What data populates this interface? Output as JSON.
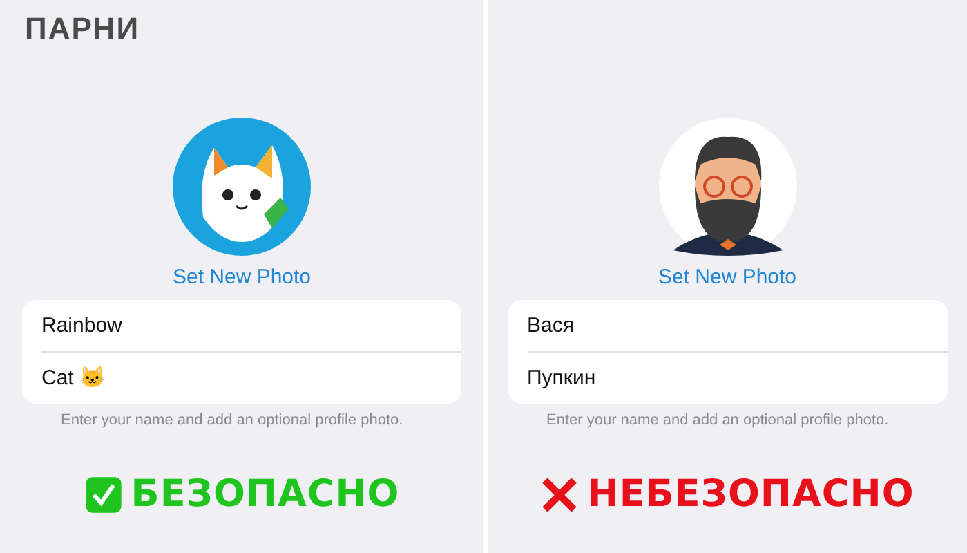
{
  "logo": {
    "text": "ПАРНИ"
  },
  "panels": [
    {
      "avatar": {
        "kind": "cat"
      },
      "set_photo": "Set New Photo",
      "fields": [
        {
          "value": "Rainbow"
        },
        {
          "value": "Cat 🐱"
        }
      ],
      "hint": "Enter your name and add an optional profile photo.",
      "verdict": {
        "kind": "safe",
        "label": "БЕЗОПАСНО"
      }
    },
    {
      "avatar": {
        "kind": "man"
      },
      "set_photo": "Set New Photo",
      "fields": [
        {
          "value": "Вася"
        },
        {
          "value": "Пупкин"
        }
      ],
      "hint": "Enter your name and add an optional profile photo.",
      "verdict": {
        "kind": "unsafe",
        "label": "НЕБЕЗОПАСНО"
      }
    }
  ]
}
